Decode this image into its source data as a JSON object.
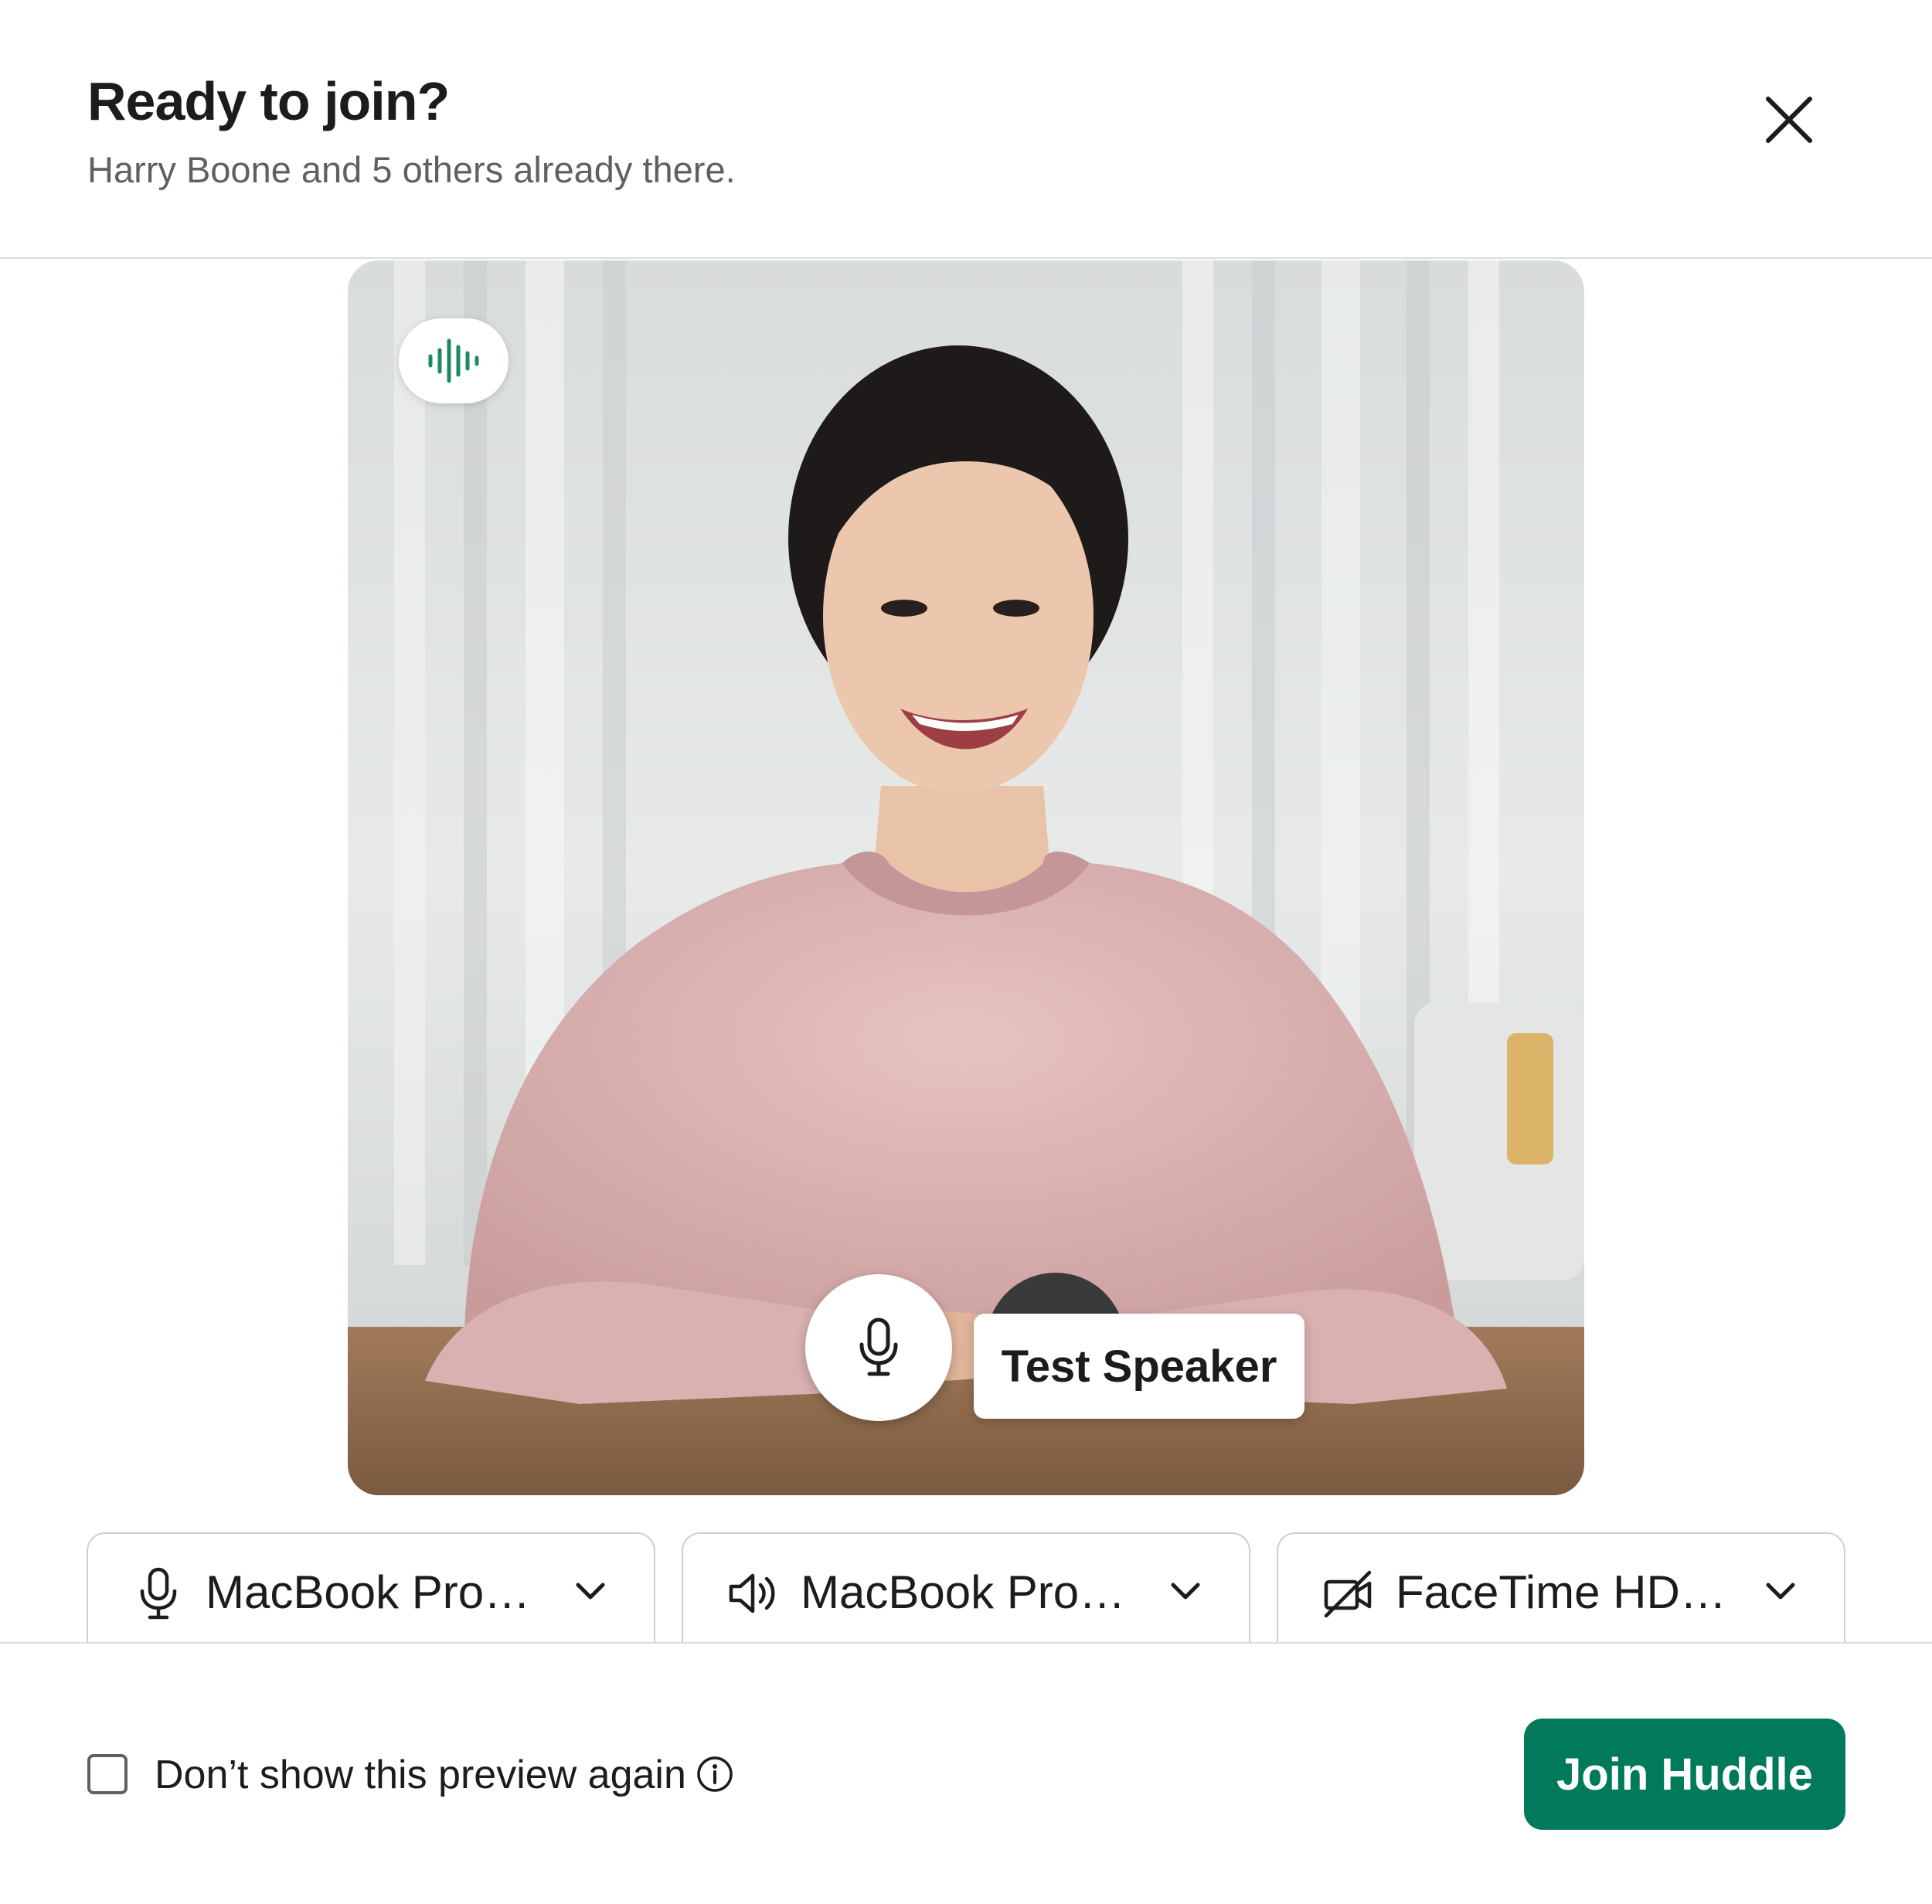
{
  "header": {
    "title": "Ready to join?",
    "subtitle": "Harry Boone and 5 others already there."
  },
  "preview": {
    "tooltip": "Test Speaker"
  },
  "devices": {
    "microphone": "MacBook Pro…",
    "speaker": "MacBook Pro…",
    "camera": "FaceTime HD…"
  },
  "footer": {
    "checkbox_label": "Don’t show this preview again",
    "checkbox_checked": false,
    "join_label": "Join Huddle"
  },
  "colors": {
    "accent": "#007a5a",
    "audio_indicator": "#1f8a5f",
    "text_primary": "#1d1c1d",
    "text_secondary": "#616061"
  }
}
